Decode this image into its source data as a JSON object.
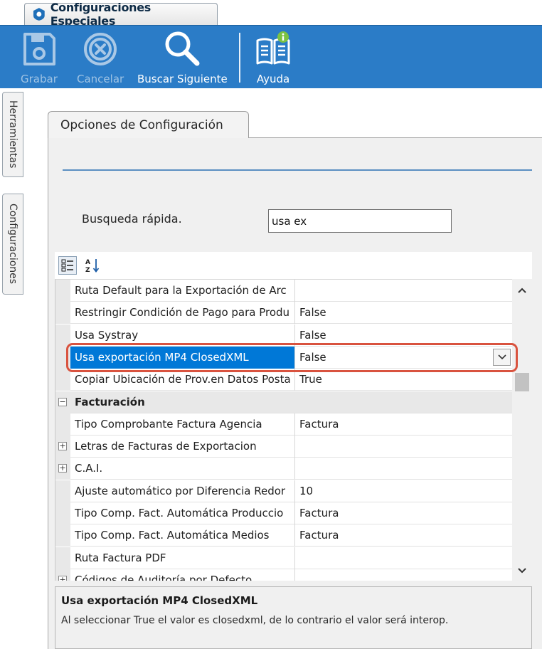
{
  "window": {
    "tab_title": "Configuraciones Especiales"
  },
  "toolbar": {
    "buttons": [
      {
        "label": "Grabar",
        "icon": "floppy-disk-icon",
        "enabled": false
      },
      {
        "label": "Cancelar",
        "icon": "cancel-circle-icon",
        "enabled": false
      },
      {
        "label": "Buscar Siguiente",
        "icon": "magnifier-icon",
        "enabled": true
      },
      {
        "label": "Ayuda",
        "icon": "help-book-icon",
        "enabled": true
      }
    ]
  },
  "side_tabs": [
    "Herramientas",
    "Configuraciones"
  ],
  "options_tab": "Opciones de Configuración",
  "quick_search": {
    "label": "Busqueda rápida.",
    "value": "usa ex"
  },
  "grid": {
    "rows": [
      {
        "name": "Ruta Default para la Exportación de Arc",
        "value": ""
      },
      {
        "name": "Restringir Condición de Pago para Produ",
        "value": "False"
      },
      {
        "name": "Usa Systray",
        "value": "False"
      },
      {
        "name": "Usa exportación MP4 ClosedXML",
        "value": "False",
        "selected": true
      },
      {
        "name": "Copiar Ubicación de Prov.en Datos Posta",
        "value": "True"
      },
      {
        "name": "Facturación",
        "value": "",
        "category": true,
        "expander": "−"
      },
      {
        "name": "Tipo Comprobante Factura Agencia",
        "value": "Factura"
      },
      {
        "name": "Letras de Facturas de Exportacion",
        "value": "",
        "expander": "+"
      },
      {
        "name": "C.A.I.",
        "value": "",
        "expander": "+"
      },
      {
        "name": "Ajuste automático por Diferencia Redor",
        "value": "10"
      },
      {
        "name": "Tipo Comp. Fact. Automática Produccio",
        "value": "Factura"
      },
      {
        "name": "Tipo Comp. Fact. Automática Medios",
        "value": "Factura"
      },
      {
        "name": "Ruta Factura PDF",
        "value": ""
      },
      {
        "name": "Códigos de Auditoría por Defecto",
        "value": "",
        "expander": "+"
      }
    ]
  },
  "description": {
    "title": "Usa exportación MP4 ClosedXML",
    "text": "Al seleccionar True el valor es closedxml, de lo contrario el valor será interop."
  },
  "colors": {
    "toolbar": "#2b7cc7",
    "selection": "#0078d7",
    "highlight_border": "#d9533f"
  }
}
